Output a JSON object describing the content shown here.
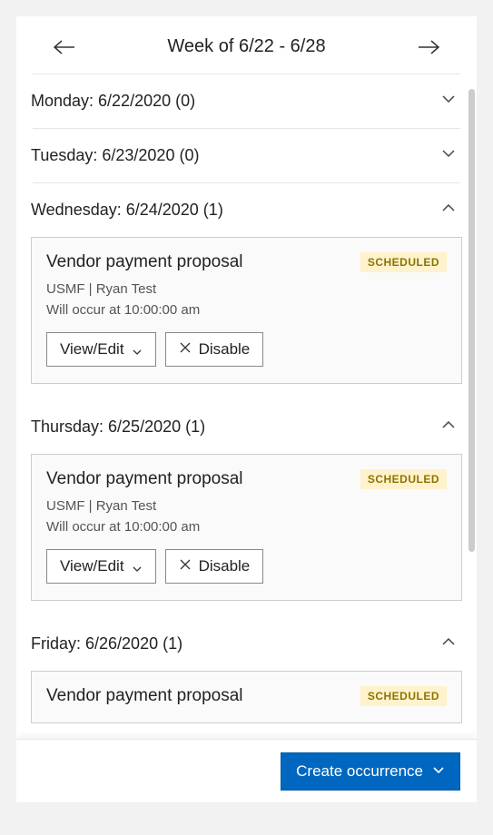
{
  "week": {
    "title": "Week of 6/22 - 6/28"
  },
  "days": {
    "monday": {
      "label": "Monday: 6/22/2020 (0)"
    },
    "tuesday": {
      "label": "Tuesday: 6/23/2020 (0)"
    },
    "wednesday": {
      "label": "Wednesday: 6/24/2020 (1)"
    },
    "thursday": {
      "label": "Thursday: 6/25/2020 (1)"
    },
    "friday": {
      "label": "Friday: 6/26/2020 (1)"
    }
  },
  "cards": {
    "wed": {
      "title": "Vendor payment proposal",
      "badge": "SCHEDULED",
      "sub": "USMF | Ryan Test",
      "time": "Will occur at 10:00:00 am",
      "viewEdit": "View/Edit",
      "disable": "Disable"
    },
    "thu": {
      "title": "Vendor payment proposal",
      "badge": "SCHEDULED",
      "sub": "USMF | Ryan Test",
      "time": "Will occur at 10:00:00 am",
      "viewEdit": "View/Edit",
      "disable": "Disable"
    },
    "fri": {
      "title": "Vendor payment proposal",
      "badge": "SCHEDULED"
    }
  },
  "footer": {
    "createOccurrence": "Create occurrence"
  }
}
